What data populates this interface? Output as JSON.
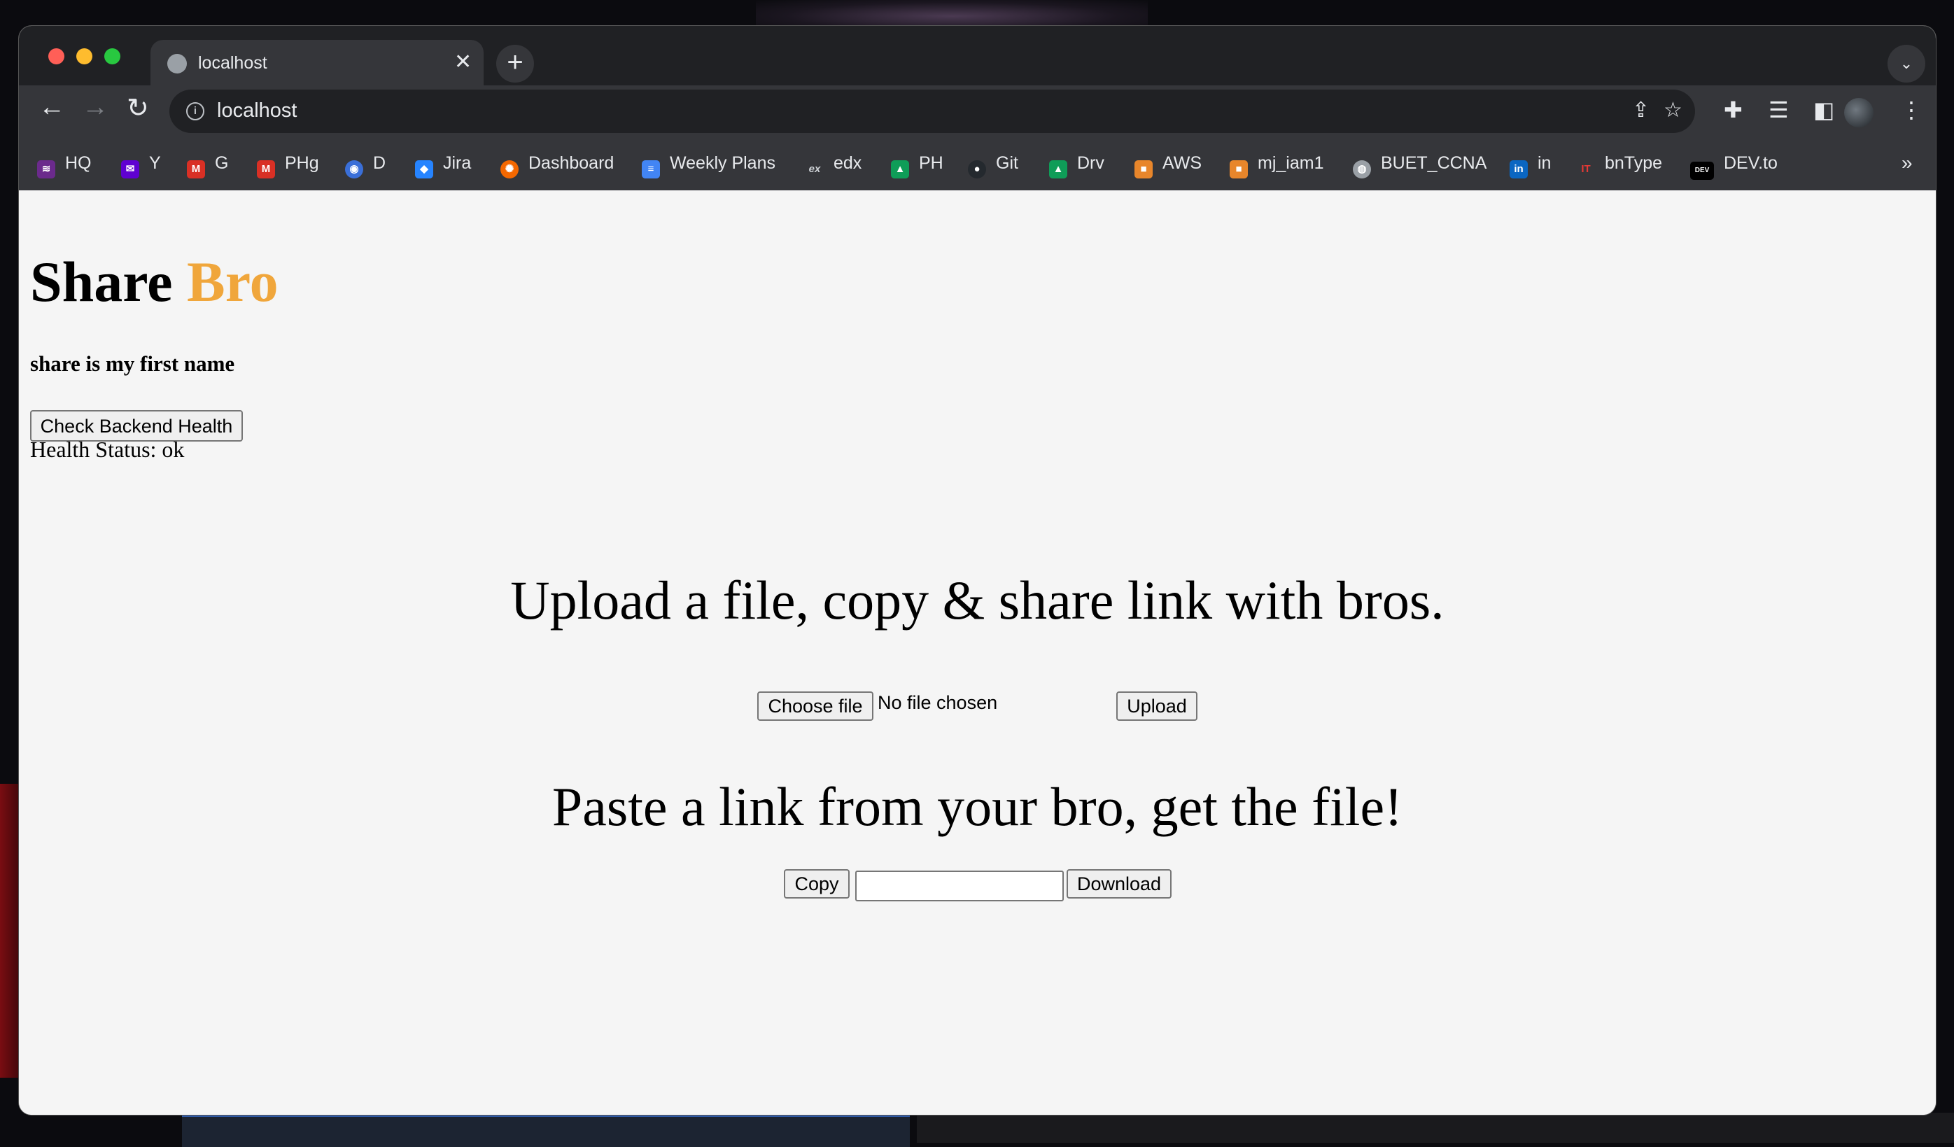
{
  "tab": {
    "title": "localhost",
    "close": "✕"
  },
  "toolbar": {
    "url": "localhost",
    "back": "←",
    "forward": "→",
    "reload": "↻",
    "new_tab": "+",
    "tab_list": "⌄"
  },
  "bookmarks": [
    {
      "label": "HQ",
      "icon": "ph-icon",
      "color": "#6b2a8c",
      "glyph": "≋"
    },
    {
      "label": "Y",
      "icon": "yahoo-mail-icon",
      "color": "#5f01d1",
      "glyph": "✉"
    },
    {
      "label": "G",
      "icon": "gmail-icon",
      "color": "#d93025",
      "glyph": "M"
    },
    {
      "label": "PHg",
      "icon": "gmail-icon",
      "color": "#d93025",
      "glyph": "M"
    },
    {
      "label": "D",
      "icon": "chrome-dev-icon",
      "color": "#3a6fd8",
      "glyph": "◉"
    },
    {
      "label": "Jira",
      "icon": "jira-icon",
      "color": "#2684ff",
      "glyph": "◆"
    },
    {
      "label": "Dashboard",
      "icon": "grafana-icon",
      "color": "#f46800",
      "glyph": "✺"
    },
    {
      "label": "Weekly Plans",
      "icon": "google-docs-icon",
      "color": "#4285f4",
      "glyph": "≡"
    },
    {
      "label": "edx",
      "icon": "edx-icon",
      "color": "#35363a",
      "glyph": "ex"
    },
    {
      "label": "PH",
      "icon": "google-drive-icon",
      "color": "#0f9d58",
      "glyph": "▲"
    },
    {
      "label": "Git",
      "icon": "github-icon",
      "color": "#24292e",
      "glyph": "●"
    },
    {
      "label": "Drv",
      "icon": "google-drive-icon",
      "color": "#0f9d58",
      "glyph": "▲"
    },
    {
      "label": "AWS",
      "icon": "aws-box-icon",
      "color": "#e8862b",
      "glyph": "■"
    },
    {
      "label": "mj_iam1",
      "icon": "aws-box-icon",
      "color": "#e8862b",
      "glyph": "■"
    },
    {
      "label": "BUET_CCNA",
      "icon": "globe-icon",
      "color": "#9aa0a6",
      "glyph": "◍"
    },
    {
      "label": "in",
      "icon": "linkedin-icon",
      "color": "#0a66c2",
      "glyph": "in"
    },
    {
      "label": "bnType",
      "icon": "bntype-icon",
      "color": "#e53935",
      "glyph": "IT"
    },
    {
      "label": "DEV.to",
      "icon": "dev-to-icon",
      "color": "#000000",
      "glyph": "DEV"
    }
  ],
  "page": {
    "title_main": "Share",
    "title_accent": "Bro",
    "accent_color": "#f0a63b",
    "tagline": "share is my first name",
    "health_button": "Check Backend Health",
    "health_status": "Health Status: ok",
    "upload_heading": "Upload a file, copy & share link with bros.",
    "choose_file_button": "Choose file",
    "no_file_text": "No file chosen",
    "upload_button": "Upload",
    "paste_heading": "Paste a link from your bro, get the file!",
    "copy_button": "Copy",
    "link_input_value": "",
    "download_button": "Download"
  }
}
